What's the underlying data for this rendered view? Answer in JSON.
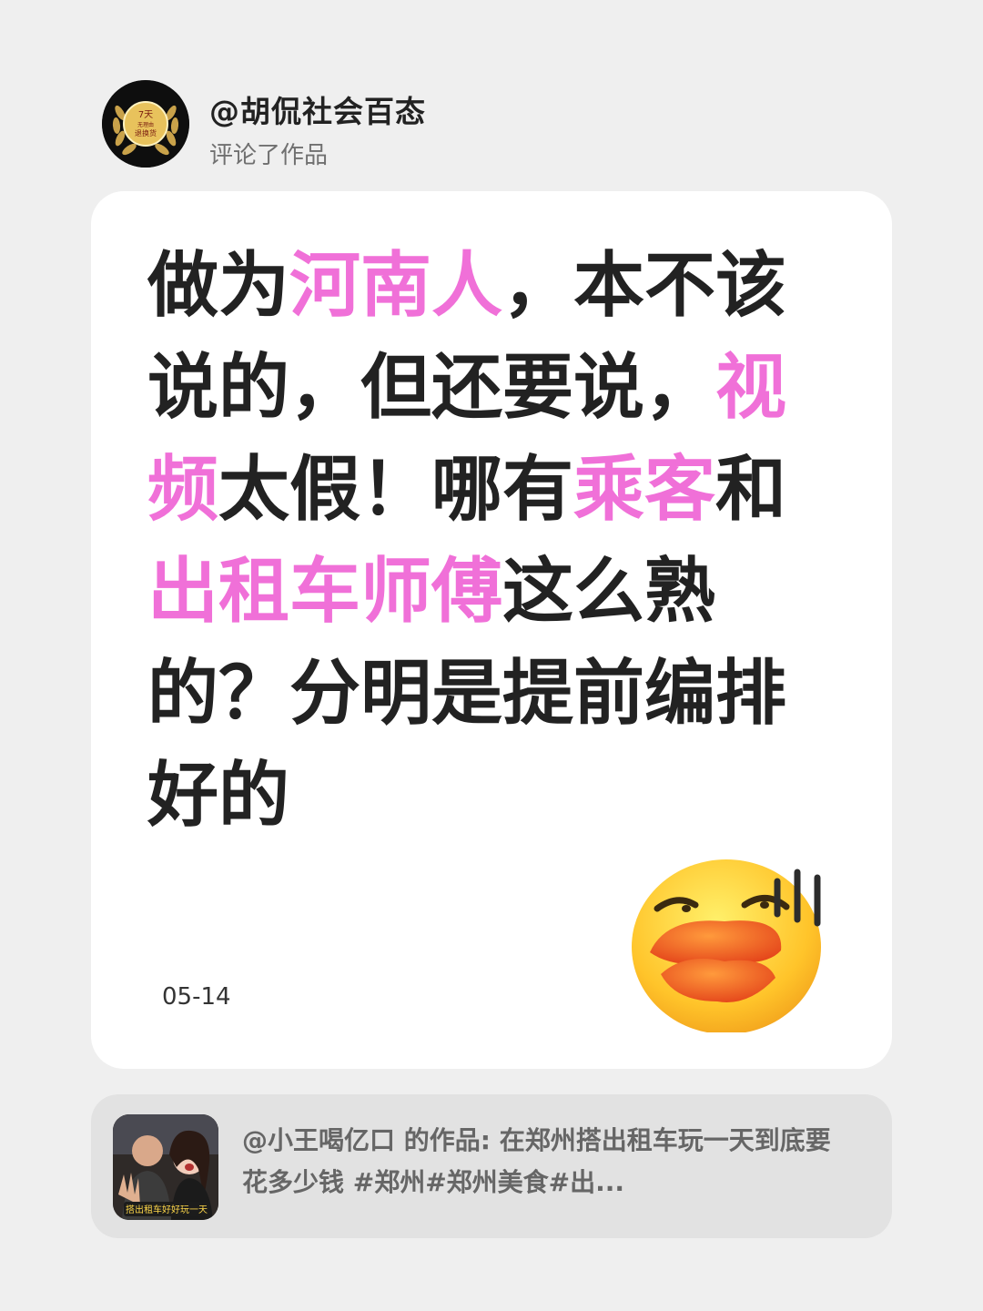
{
  "header": {
    "user_name": "@胡侃社会百态",
    "action": "评论了作品",
    "avatar_icon": "laurel-badge-icon",
    "avatar_text_top": "7天",
    "avatar_text_mid": "无理由",
    "avatar_text_bottom": "退换货"
  },
  "comment": {
    "segments": [
      {
        "text": "做为",
        "highlight": false
      },
      {
        "text": "河南人",
        "highlight": true
      },
      {
        "text": "，本不该说的，但还要说，",
        "highlight": false
      },
      {
        "text": "视频",
        "highlight": true
      },
      {
        "text": "太假！哪有",
        "highlight": false
      },
      {
        "text": "乘客",
        "highlight": true
      },
      {
        "text": "和",
        "highlight": false
      },
      {
        "text": "出租车师傅",
        "highlight": true
      },
      {
        "text": "这么熟的？分明是提前编排好的",
        "highlight": false
      }
    ],
    "date": "05-14",
    "emoji_icon": "duck-face-emoji-icon"
  },
  "colors": {
    "highlight": "#f070d8",
    "text": "#222222",
    "background": "#efefef"
  },
  "reference": {
    "text": "@小王喝亿口 的作品: 在郑州搭出租车玩一天到底要花多少钱 #郑州#郑州美食#出...",
    "thumbnail_caption": "搭出租车好好玩一天"
  }
}
